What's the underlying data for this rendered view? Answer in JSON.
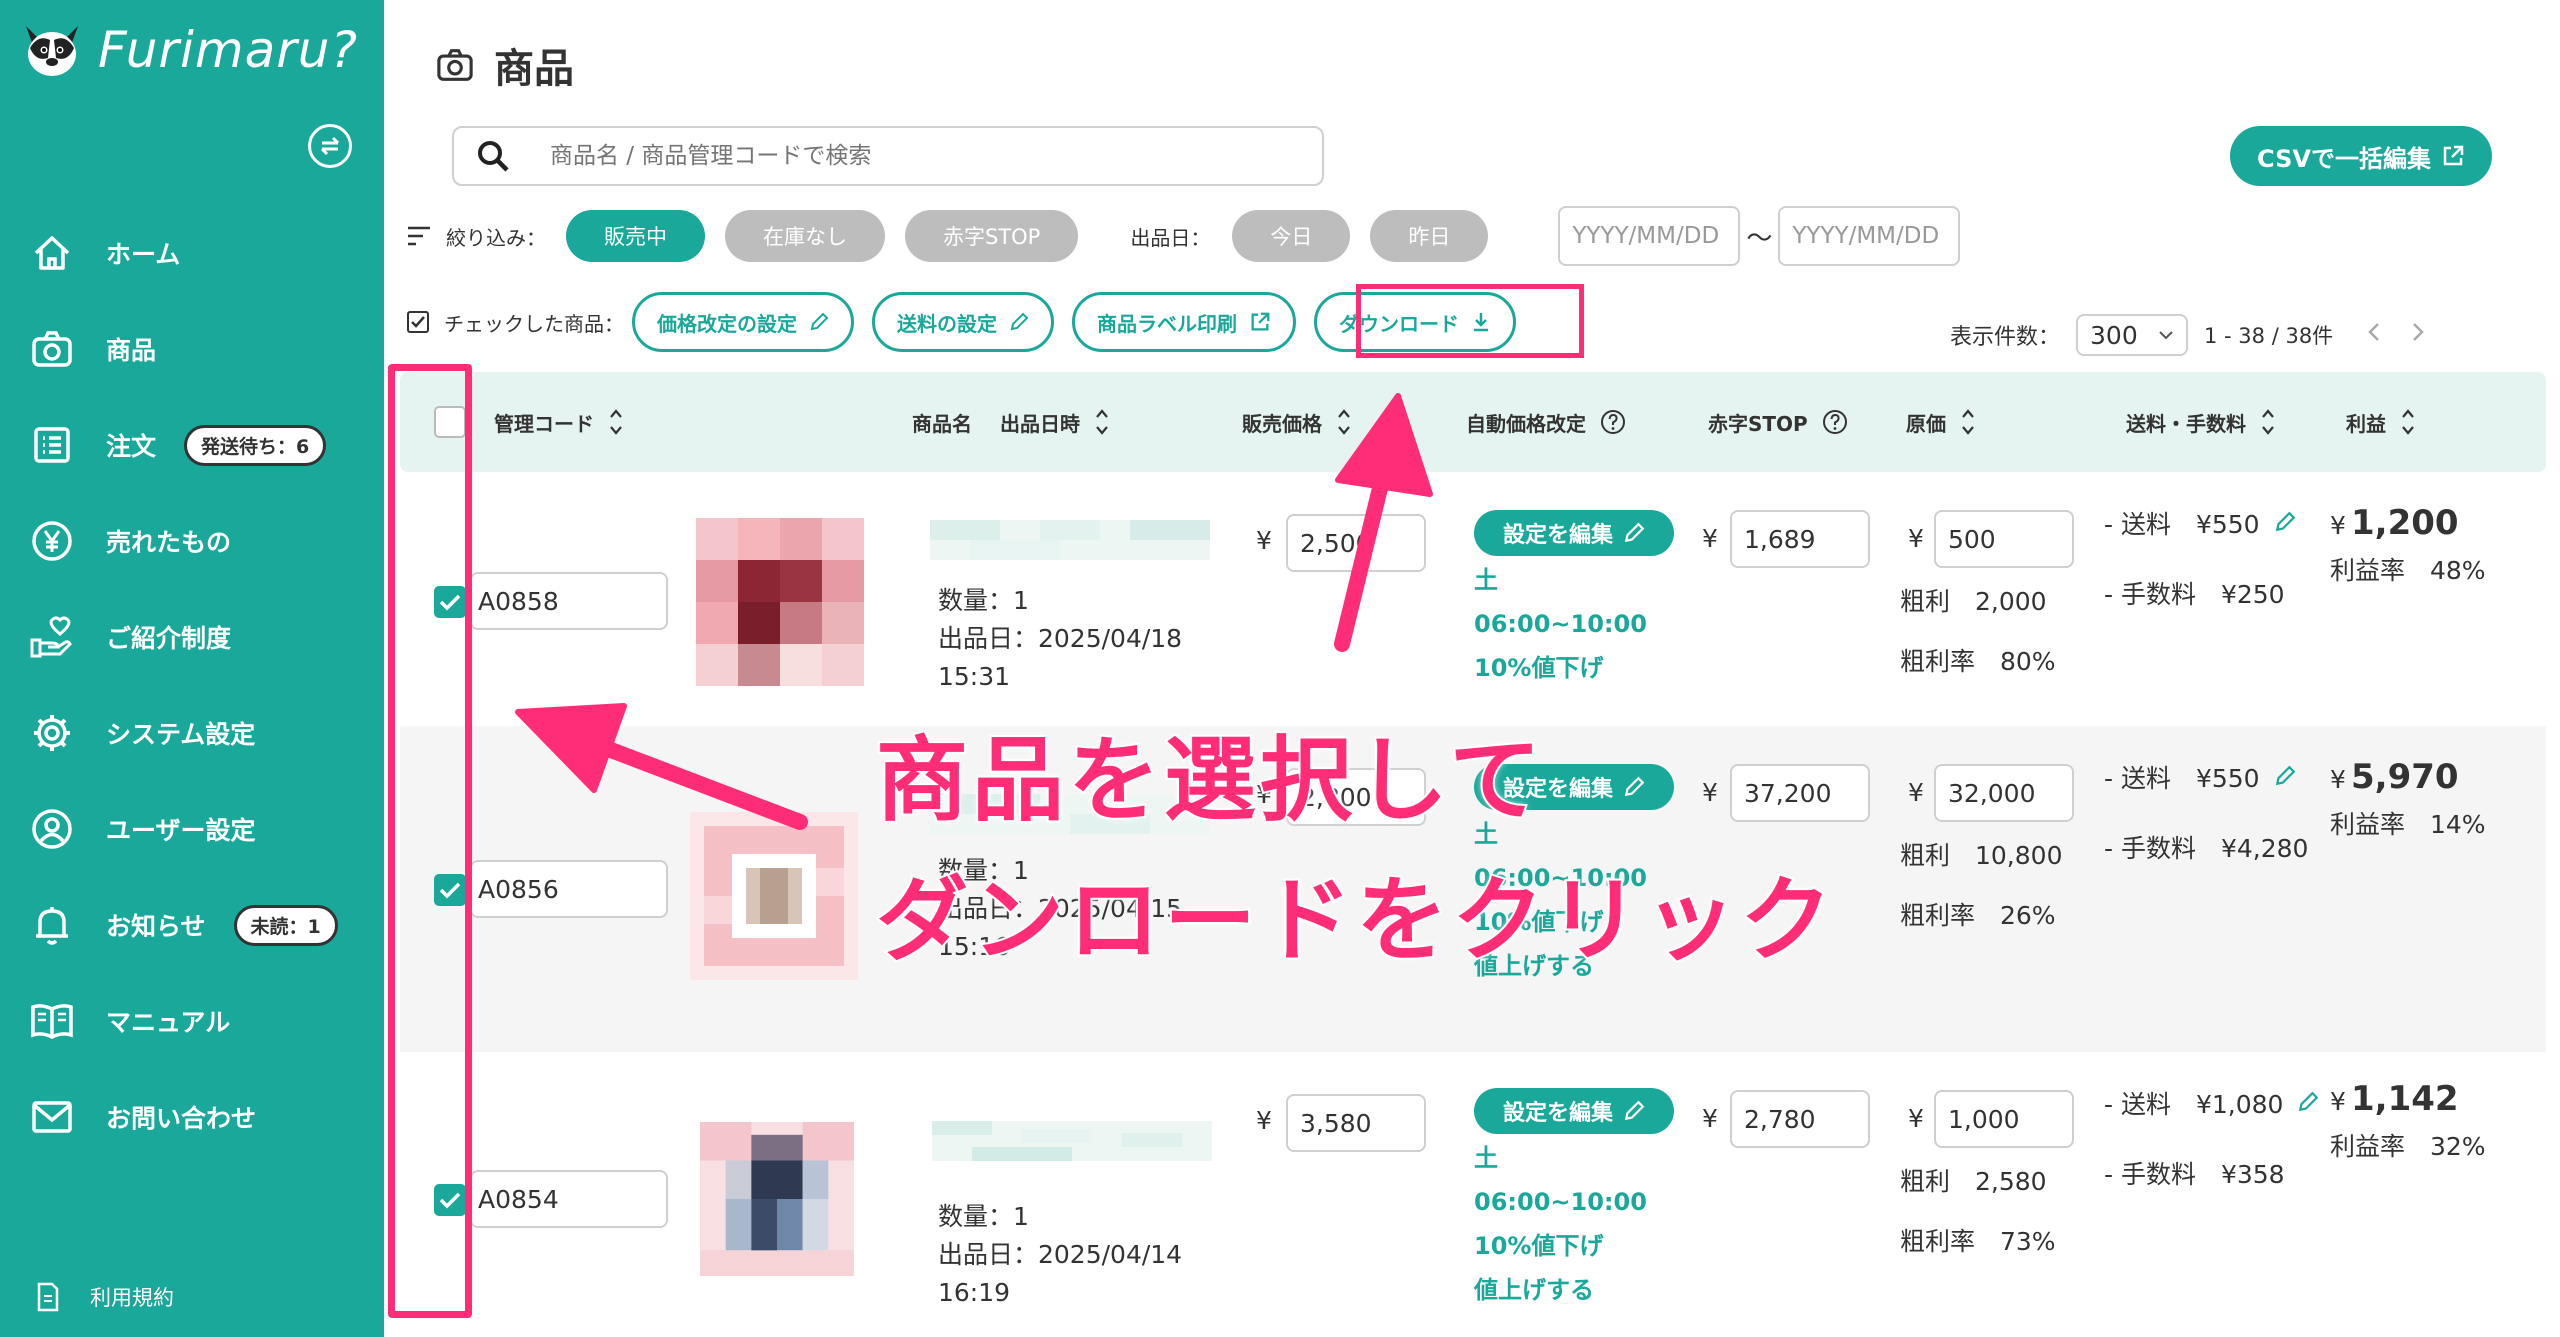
{
  "app": {
    "logo_text": "Furimaru?"
  },
  "sidebar": {
    "items": [
      {
        "label": "ホーム",
        "icon": "home-icon"
      },
      {
        "label": "商品",
        "icon": "camera-icon"
      },
      {
        "label": "注文",
        "icon": "list-icon",
        "badge": "発送待ち：6"
      },
      {
        "label": "売れたもの",
        "icon": "yen-icon"
      },
      {
        "label": "ご紹介制度",
        "icon": "referral-icon"
      },
      {
        "label": "システム設定",
        "icon": "gear-icon"
      },
      {
        "label": "ユーザー設定",
        "icon": "user-icon"
      },
      {
        "label": "お知らせ",
        "icon": "bell-icon",
        "badge": "未読：1"
      },
      {
        "label": "マニュアル",
        "icon": "book-icon"
      },
      {
        "label": "お問い合わせ",
        "icon": "mail-icon"
      }
    ],
    "terms": "利用規約"
  },
  "header": {
    "title": "商品",
    "search_placeholder": "商品名 / 商品管理コードで検索",
    "csv_button": "CSVで一括編集"
  },
  "filters": {
    "label": "絞り込み：",
    "status": [
      "販売中",
      "在庫なし",
      "赤字STOP"
    ],
    "date_label": "出品日：",
    "dates": [
      "今日",
      "昨日"
    ],
    "date_placeholder": "YYYY/MM/DD",
    "tilde": "〜"
  },
  "actions": {
    "label": "チェックした商品：",
    "price_rule": "価格改定の設定",
    "shipping": "送料の設定",
    "label_print": "商品ラベル印刷",
    "download": "ダウンロード"
  },
  "pager": {
    "label": "表示件数：",
    "per_page": "300",
    "range": "1 - 38 / 38件"
  },
  "table": {
    "headers": {
      "code": "管理コード",
      "name": "商品名",
      "listed": "出品日時",
      "price": "販売価格",
      "auto": "自動価格改定",
      "stop": "赤字STOP",
      "cost": "原価",
      "fee": "送料・手数料",
      "profit": "利益"
    },
    "rows": [
      {
        "code": "A0858",
        "qty": "数量：1",
        "date": "出品日：2025/04/18",
        "time": "15:31",
        "price": "2,500",
        "edit": "設定を編集",
        "rule1": "土",
        "rule2": "06:00~10:00",
        "rule3": "10%値下げ",
        "rule4": "",
        "stop": "1,689",
        "cost": "500",
        "gp": "粗利　2,000",
        "gpr": "粗利率　80%",
        "ship": "- 送料　¥550",
        "fee": "- 手数料　¥250",
        "profit": "1,200",
        "rate": "利益率　48%"
      },
      {
        "code": "A0856",
        "qty": "数量：1",
        "date": "出品日：2025/04/15",
        "time": "15:16",
        "price": "2,800",
        "edit": "設定を編集",
        "rule1": "土",
        "rule2": "06:00~10:00",
        "rule3": "10%値下げ",
        "rule4": "値上げする",
        "stop": "37,200",
        "cost": "32,000",
        "gp": "粗利　10,800",
        "gpr": "粗利率　26%",
        "ship": "- 送料　¥550",
        "fee": "- 手数料　¥4,280",
        "profit": "5,970",
        "rate": "利益率　14%"
      },
      {
        "code": "A0854",
        "qty": "数量：1",
        "date": "出品日：2025/04/14",
        "time": "16:19",
        "price": "3,580",
        "edit": "設定を編集",
        "rule1": "土",
        "rule2": "06:00~10:00",
        "rule3": "10%値下げ",
        "rule4": "値上げする",
        "stop": "2,780",
        "cost": "1,000",
        "gp": "粗利　2,580",
        "gpr": "粗利率　73%",
        "ship": "- 送料　¥1,080",
        "fee": "- 手数料　¥358",
        "profit": "1,142",
        "rate": "利益率　32%"
      }
    ],
    "currency": "¥"
  },
  "annotation": {
    "line1": "商品を選択して",
    "line2": "ダンロードをクリック",
    "color": "#ff2d78"
  },
  "colors": {
    "accent": "#1aa89a",
    "highlight": "#ff2d78"
  }
}
